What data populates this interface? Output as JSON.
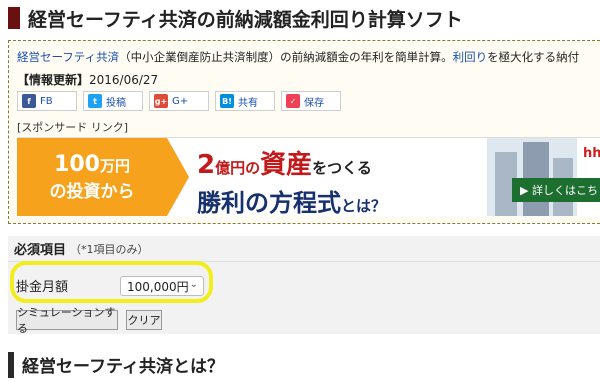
{
  "page": {
    "title": "経営セーフティ共済の前納減額金利回り計算ソフト"
  },
  "info": {
    "link1": "経営セーフティ共済",
    "desc_mid": "（中小企業倒産防止共済制度）の前納減額金の年利を簡単計算。",
    "link2": "利回り",
    "desc_end": "を極大化する納付",
    "updated_label": "【情報更新】",
    "updated_date": "2016/06/27",
    "sponsor": "[スポンサード リンク]"
  },
  "share": {
    "buttons": [
      {
        "icon": "facebook-icon",
        "label": "FB",
        "color": "#3b5998",
        "glyph": "f"
      },
      {
        "icon": "twitter-icon",
        "label": "投稿",
        "color": "#1da1f2",
        "glyph": "t"
      },
      {
        "icon": "google-plus-icon",
        "label": "G+",
        "color": "#dd4b39",
        "glyph": "g+"
      },
      {
        "icon": "hatena-icon",
        "label": "共有",
        "color": "#008fde",
        "glyph": "B!"
      },
      {
        "icon": "pocket-icon",
        "label": "保存",
        "color": "#ef4056",
        "glyph": "✓"
      }
    ]
  },
  "banner": {
    "left_amount": "100",
    "left_unit": "万円",
    "left_line2": "の投資から",
    "mid_num": "2",
    "mid_unit": "億円",
    "mid_no": "の",
    "mid_asset": "資産",
    "mid_tail": "をつくる",
    "mid_line2": "勝利の方程式",
    "mid_line2_tail": "とは？",
    "logo": "hho",
    "cta": "▶ 詳しくはこち"
  },
  "form": {
    "required_label": "必須項目",
    "required_note": "（*1項目のみ）",
    "field_label": "掛金月額",
    "select_value": "100,000円",
    "simulate_button": "シミュレーションする",
    "clear_button": "クリア"
  },
  "section": {
    "heading": "経営セーフティ共済とは？"
  },
  "colors": {
    "title_mark": "#6b1010",
    "highlight": "#f2ee1e",
    "link": "#1a4fb0"
  }
}
